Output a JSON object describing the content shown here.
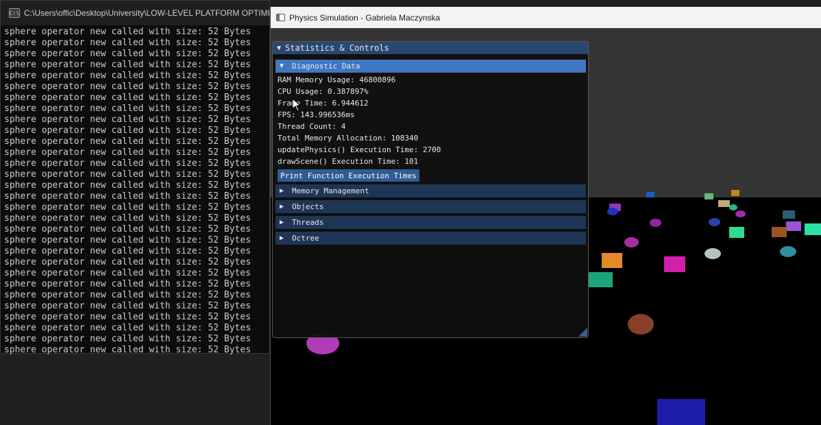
{
  "console": {
    "title": "C:\\Users\\offic\\Desktop\\University\\LOW-LEVEL PLATFORM OPTIMISA",
    "icon": "console-icon",
    "lines": [
      "sphere operator new called with size: 52 Bytes",
      "sphere operator new called with size: 52 Bytes",
      "sphere operator new called with size: 52 Bytes",
      "sphere operator new called with size: 52 Bytes",
      "sphere operator new called with size: 52 Bytes",
      "sphere operator new called with size: 52 Bytes",
      "sphere operator new called with size: 52 Bytes",
      "sphere operator new called with size: 52 Bytes",
      "sphere operator new called with size: 52 Bytes",
      "sphere operator new called with size: 52 Bytes",
      "sphere operator new called with size: 52 Bytes",
      "sphere operator new called with size: 52 Bytes",
      "sphere operator new called with size: 52 Bytes",
      "sphere operator new called with size: 52 Bytes",
      "sphere operator new called with size: 52 Bytes",
      "sphere operator new called with size: 52 Bytes",
      "sphere operator new called with size: 52 Bytes",
      "sphere operator new called with size: 52 Bytes",
      "sphere operator new called with size: 52 Bytes",
      "sphere operator new called with size: 52 Bytes",
      "sphere operator new called with size: 52 Bytes",
      "sphere operator new called with size: 52 Bytes",
      "sphere operator new called with size: 52 Bytes",
      "sphere operator new called with size: 52 Bytes",
      "sphere operator new called with size: 52 Bytes",
      "sphere operator new called with size: 52 Bytes",
      "sphere operator new called with size: 52 Bytes",
      "sphere operator new called with size: 52 Bytes",
      "sphere operator new called with size: 52 Bytes",
      "sphere operator new called with size: 52 Bytes"
    ]
  },
  "sim_window": {
    "title": "Physics Simulation - Gabriela Maczynska",
    "icon": "window-icon"
  },
  "panel": {
    "title": "Statistics & Controls",
    "diagnostic": {
      "header": "Diagnostic Data",
      "stats": [
        "RAM Memory Usage: 46800896",
        "CPU Usage: 0.387897%",
        "Frame Time: 6.944612",
        "FPS: 143.996536ms",
        "Thread Count: 4",
        "Total Memory Allocation: 108340",
        "updatePhysics() Execution Time: 2700",
        "drawScene() Execution Time: 101"
      ],
      "button": "Print Function Execution Times"
    },
    "sections": [
      "Memory Management",
      "Objects",
      "Threads",
      "Octree"
    ]
  },
  "colors": {
    "panel_title": "#29476f",
    "header": "#1e3556",
    "header_active": "#4177c2",
    "button": "#2f5c94"
  },
  "scene_objects": [
    {
      "kind": "box",
      "color": "#d21fae"
    },
    {
      "kind": "box",
      "color": "#e58a2a"
    },
    {
      "kind": "box",
      "color": "#1aa67a"
    },
    {
      "kind": "box",
      "color": "#2ddb96"
    },
    {
      "kind": "box",
      "color": "#29e0a6"
    },
    {
      "kind": "box",
      "color": "#9a52d8"
    },
    {
      "kind": "box",
      "color": "#9b5320"
    },
    {
      "kind": "box",
      "color": "#2a5e72"
    },
    {
      "kind": "box",
      "color": "#c0a97c"
    },
    {
      "kind": "box",
      "color": "#6ab580"
    },
    {
      "kind": "box",
      "color": "#c0881a"
    },
    {
      "kind": "box",
      "color": "#1a5fc0"
    },
    {
      "kind": "box",
      "color": "#8d37b8"
    },
    {
      "kind": "box",
      "color": "#1c1cab"
    },
    {
      "kind": "ball",
      "color": "#b03cb8"
    },
    {
      "kind": "ball",
      "color": "#8a3f28"
    },
    {
      "kind": "ball",
      "color": "#b3c4bd"
    },
    {
      "kind": "ball",
      "color": "#2e8f9e"
    },
    {
      "kind": "ball",
      "color": "#a42fa2"
    },
    {
      "kind": "ball",
      "color": "#2a43a8"
    },
    {
      "kind": "ball",
      "color": "#2233c8"
    },
    {
      "kind": "ball",
      "color": "#8a2a96"
    },
    {
      "kind": "ball",
      "color": "#2bb58a"
    },
    {
      "kind": "ball",
      "color": "#9b2fa8"
    }
  ]
}
